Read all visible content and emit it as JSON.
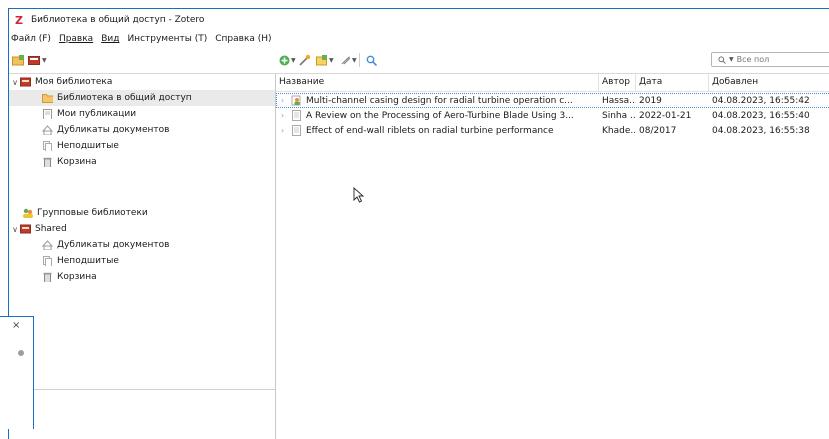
{
  "window": {
    "title": "Библиотека в общий доступ - Zotero"
  },
  "menu": [
    "Файл (F)",
    "Правка",
    "Вид",
    "Инструменты (T)",
    "Справка (H)"
  ],
  "search": {
    "placeholder": "Все пол"
  },
  "tree": {
    "my_library": "Моя библиотека",
    "items": [
      {
        "label": "Библиотека в общий доступ",
        "icon": "folder-icon",
        "selected": true
      },
      {
        "label": "Мои публикации",
        "icon": "publications-icon"
      },
      {
        "label": "Дубликаты документов",
        "icon": "duplicates-icon"
      },
      {
        "label": "Неподшитые",
        "icon": "unfiled-icon"
      },
      {
        "label": "Корзина",
        "icon": "trash-icon"
      }
    ],
    "group_header": "Групповые библиотеки",
    "group": {
      "name": "Shared",
      "items": [
        {
          "label": "Дубликаты документов",
          "icon": "duplicates-icon"
        },
        {
          "label": "Неподшитые",
          "icon": "unfiled-icon"
        },
        {
          "label": "Корзина",
          "icon": "trash-icon"
        }
      ]
    }
  },
  "columns": {
    "title": "Название",
    "author": "Автор",
    "date": "Дата",
    "added": "Добавлен"
  },
  "rows": [
    {
      "title": "Multi-channel casing design for radial turbine operation c...",
      "author": "Hassa...",
      "date": "2019",
      "added": "04.08.2023, 16:55:42",
      "icon": "person-document-icon"
    },
    {
      "title": "A Review on the Processing of Aero-Turbine Blade Using 3...",
      "author": "Sinha ...",
      "date": "2022-01-21",
      "added": "04.08.2023, 16:55:40",
      "icon": "document-icon"
    },
    {
      "title": "Effect of end-wall riblets on radial turbine performance",
      "author": "Khade...",
      "date": "08/2017",
      "added": "04.08.2023, 16:55:38",
      "icon": "document-icon"
    }
  ],
  "side_panel": {
    "close": "×"
  }
}
